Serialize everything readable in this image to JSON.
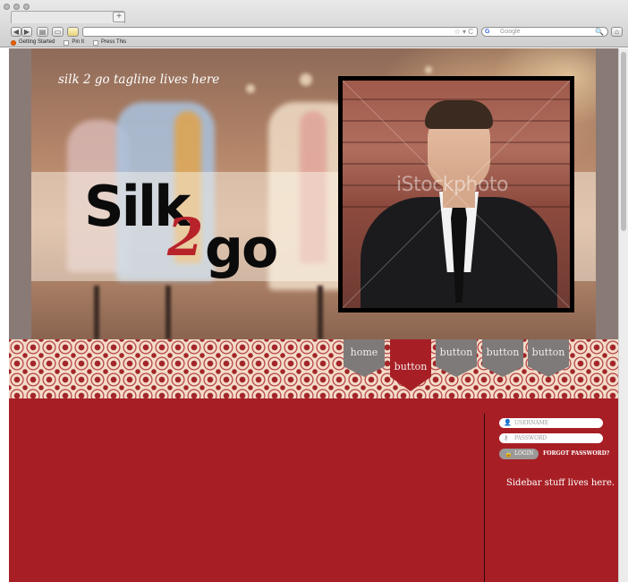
{
  "browser": {
    "new_tab_glyph": "+",
    "back_glyph": "◀",
    "forward_glyph": "▶",
    "url_icons": "☆ ▾ C",
    "search_engine": "G",
    "search_placeholder": "Google",
    "search_glyph": "🔍",
    "home_glyph": "⌂",
    "bookmarks": [
      {
        "label": "Getting Started",
        "icon": "firefox-icon"
      },
      {
        "label": "Pin It",
        "icon": "bookmark-icon"
      },
      {
        "label": "Press This",
        "icon": "bookmark-icon"
      }
    ]
  },
  "hero": {
    "tagline": "silk 2 go tagline lives here",
    "logo": {
      "part1": "Silk",
      "part2": "2",
      "part3": "go"
    },
    "watermark": "iStockphoto"
  },
  "nav": {
    "items": [
      {
        "label": "home",
        "active": false
      },
      {
        "label": "button",
        "active": true
      },
      {
        "label": "button",
        "active": false
      },
      {
        "label": "button",
        "active": false
      },
      {
        "label": "button",
        "active": false
      }
    ]
  },
  "sidebar": {
    "username_placeholder": "USERNAME",
    "password_placeholder": "PASSWORD",
    "login_label": "LOGIN",
    "forgot_label": "FORGOT PASSWORD?",
    "text": "Sidebar stuff lives here."
  },
  "colors": {
    "brand_red": "#a71f25",
    "tab_gray": "#7e7a79",
    "pattern_cream": "#f2dcc8"
  }
}
